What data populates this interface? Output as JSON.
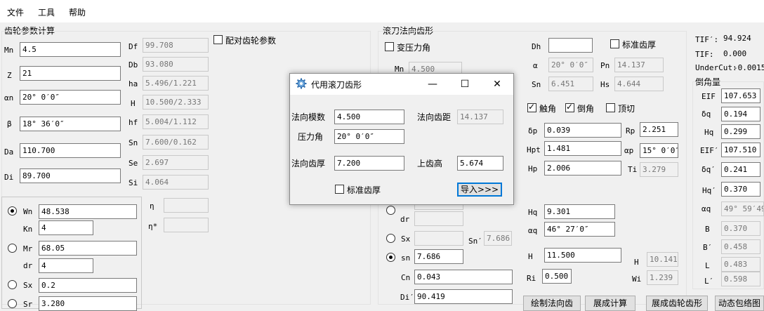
{
  "menu": [
    "文件",
    "工具",
    "帮助"
  ],
  "left": {
    "title": "齿轮参数计算",
    "fields": [
      {
        "label": "Mn",
        "value": "4.5"
      },
      {
        "label": "Z",
        "value": "21"
      },
      {
        "label": "αn",
        "value": "20° 0′0″"
      },
      {
        "label": "β",
        "value": "18° 36′0″"
      },
      {
        "label": "Da",
        "value": "110.700"
      },
      {
        "label": "Di",
        "value": "89.700"
      }
    ],
    "outputs": [
      {
        "label": "Df",
        "value": "99.708"
      },
      {
        "label": "Db",
        "value": "93.080"
      },
      {
        "label": "ha",
        "value": "5.496/1.221"
      },
      {
        "label": "H",
        "value": "10.500/2.333"
      },
      {
        "label": "hf",
        "value": "5.004/1.112"
      },
      {
        "label": "Sn",
        "value": "7.600/0.162"
      },
      {
        "label": "Se",
        "value": "2.697"
      },
      {
        "label": "Si",
        "value": "4.064"
      }
    ],
    "pair_checkbox": "配对齿轮参数",
    "radio_rows": [
      {
        "label": "Wn",
        "value": "48.538",
        "selected": true
      },
      {
        "label": "Kn",
        "value": "4"
      },
      {
        "label": "Mr",
        "value": "68.05",
        "selected": false
      },
      {
        "label": "dr",
        "value": "4"
      },
      {
        "label": "Sx",
        "value": "0.2",
        "selected": false
      },
      {
        "label": "Sr",
        "value": "3.280"
      }
    ],
    "eta": "η",
    "eta_star": "η*"
  },
  "right": {
    "title": "滚刀法向齿形",
    "var_pressure": "变压力角",
    "mn_label": "Mn",
    "mn_value": "4.500",
    "dh_label": "Dh",
    "dh_value": "",
    "std_tooth": "标准齿厚",
    "alpha_label": "α",
    "alpha_value": "20° 0′0″",
    "pn_label": "Pn",
    "pn_value": "14.137",
    "sn_label": "Sn",
    "sn_value": "6.451",
    "hs_label": "Hs",
    "hs_value": "4.644",
    "chk_touch": "触角",
    "chk_chamfer": "倒角",
    "chk_tip": "顶切",
    "dp_label": "δp",
    "dp_value": "0.039",
    "rp_label": "Rp",
    "rp_value": "2.251",
    "hpt_label": "Hpt",
    "hpt_value": "1.481",
    "ap_label": "αp",
    "ap_value": "15° 0′0″",
    "hp_label": "Hp",
    "hp_value": "2.006",
    "ti_label": "Ti",
    "ti_value": "3.279",
    "dr_label": "dr",
    "hq_label": "Hq",
    "hq_value": "9.301",
    "aq_label": "αq",
    "aq_value": "46° 27′0″",
    "sx_label": "Sx",
    "snp_label": "Sn′",
    "snp_value": "7.686",
    "sn2_label": "sn",
    "sn2_value": "7.686",
    "h_label": "H",
    "h_value": "11.500",
    "h2_label": "H",
    "h2_value": "10.141",
    "cn_label": "Cn",
    "cn_value": "0.043",
    "ri_label": "Ri",
    "ri_value": "0.500",
    "wi_label": "Wi",
    "wi_value": "1.239",
    "di_label": "Di′",
    "di_value": "90.419",
    "bottom_buttons": [
      "绘制法向齿",
      "展成计算",
      "展成齿轮齿形",
      "动态包络图"
    ]
  },
  "far_right": {
    "tif_p_label": "TIF′:",
    "tif_p_value": "94.924",
    "tif_label": "TIF:",
    "tif_value": "0.000",
    "undercut_label": "UnderCut:",
    "undercut_value": "-0.0015",
    "chamfer_title": "倒角量",
    "rows": [
      {
        "label": "EIF",
        "value": "107.653",
        "editable": true
      },
      {
        "label": "δq",
        "value": "0.194",
        "editable": true
      },
      {
        "label": "Hq",
        "value": "0.299",
        "editable": true
      },
      {
        "label": "EIF′",
        "value": "107.510",
        "editable": true
      },
      {
        "label": "δq′",
        "value": "0.241",
        "editable": true
      },
      {
        "label": "Hq′",
        "value": "0.370",
        "editable": true
      },
      {
        "label": "αq",
        "value": "49° 59′49″",
        "editable": false
      },
      {
        "label": "B",
        "value": "0.370",
        "editable": false
      },
      {
        "label": "B′",
        "value": "0.458",
        "editable": false
      },
      {
        "label": "L",
        "value": "0.483",
        "editable": false
      },
      {
        "label": "L′",
        "value": "0.598",
        "editable": false
      }
    ]
  },
  "dialog": {
    "title": "代用滚刀齿形",
    "minimize": "—",
    "maximize": "☐",
    "close": "✕",
    "normal_module_label": "法向模数",
    "normal_module_value": "4.500",
    "normal_pitch_label": "法向齿距",
    "normal_pitch_value": "14.137",
    "pressure_angle_label": "压力角",
    "pressure_angle_value": "20° 0′0″",
    "normal_thickness_label": "法向齿厚",
    "normal_thickness_value": "7.200",
    "addendum_label": "上齿高",
    "addendum_value": "5.674",
    "std_thickness": "标准齿厚",
    "import_button": "导入>>>"
  }
}
